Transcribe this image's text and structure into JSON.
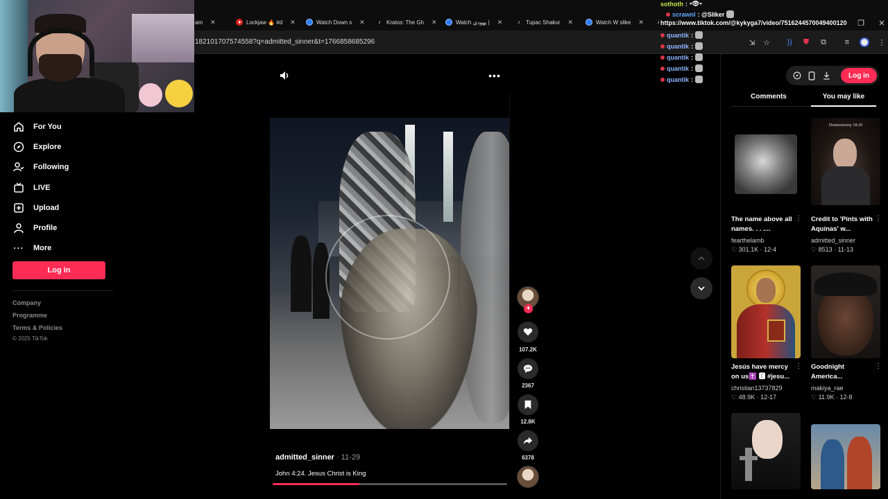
{
  "browser": {
    "tabs": [
      {
        "label": "am",
        "favicon": "none"
      },
      {
        "label": "Lockjaw 🔥 #d",
        "favicon": "youtube-icon"
      },
      {
        "label": "Watch Down s",
        "favicon": "chrome-icon"
      },
      {
        "label": "Kratos: The Gh",
        "favicon": "tiktok-icon"
      },
      {
        "label": "Watch يهودي |",
        "favicon": "chrome-icon"
      },
      {
        "label": "Tupac Shakur",
        "favicon": "tiktok-icon"
      },
      {
        "label": "Watch W slike",
        "favicon": "chrome-icon"
      }
    ],
    "url": "182101707574558?q=admitted_sinner&t=1766858685296"
  },
  "chat": {
    "messages": [
      {
        "user": "sothoth",
        "text": ":",
        "color": "#c6e24a"
      },
      {
        "user": "scrawnl",
        "text": ": @Sliker",
        "color": "#5fa7ff"
      },
      {
        "user": "quantik",
        "text": ":",
        "color": "#8fb4ff"
      },
      {
        "user": "quantik",
        "text": ":",
        "color": "#8fb4ff"
      },
      {
        "user": "quantik",
        "text": ":",
        "color": "#8fb4ff"
      },
      {
        "user": "quantik",
        "text": ":",
        "color": "#8fb4ff"
      },
      {
        "user": "quantik",
        "text": ":",
        "color": "#8fb4ff"
      }
    ],
    "link": "https://www.tiktok.com/@kykyga7/video/7516244570049400120"
  },
  "sidebar": {
    "items": [
      {
        "label": "For You",
        "icon": "home-icon"
      },
      {
        "label": "Explore",
        "icon": "compass-icon"
      },
      {
        "label": "Following",
        "icon": "following-icon"
      },
      {
        "label": "LIVE",
        "icon": "live-icon"
      },
      {
        "label": "Upload",
        "icon": "upload-icon"
      },
      {
        "label": "Profile",
        "icon": "profile-icon"
      },
      {
        "label": "More",
        "icon": "more-icon"
      }
    ],
    "login_label": "Log in",
    "footer_links": [
      "Company",
      "Programme",
      "Terms & Policies"
    ],
    "copyright": "© 2025 TikTok"
  },
  "video": {
    "author": "admitted_sinner",
    "date": " · 11-29",
    "caption": "John 4:24. Jesus Christ is King",
    "progress": 0.37,
    "likes": "107.2K",
    "comments": "2367",
    "saves": "12.8K",
    "shares": "6378"
  },
  "right_panel": {
    "login_label": "Log in",
    "tabs": [
      "Comments",
      "You may like"
    ],
    "active_tab": "You may like",
    "cards": [
      {
        "title": "The name above all names. . . ....",
        "author": "fearthelamb",
        "likes": "301.1K",
        "date": "12-4",
        "overlay": ""
      },
      {
        "title": "Credit to 'Pints with Aquinas' w...",
        "author": "admitted_sinner",
        "likes": "8513",
        "date": "11-13",
        "overlay": "Deuteronomy 18:20"
      },
      {
        "title": "Jesús have mercy on us✝️ 🅴 #jesu...",
        "author": "christian13737829",
        "likes": "48.9K",
        "date": "12-17",
        "overlay": ""
      },
      {
        "title": "Goodnight America...",
        "author": "makiya_rae",
        "likes": "11.9K",
        "date": "12-8",
        "overlay": ""
      },
      {
        "title": "",
        "author": "",
        "likes": "",
        "date": "",
        "overlay": ""
      },
      {
        "title": "",
        "author": "",
        "likes": "",
        "date": "",
        "overlay": ""
      }
    ]
  },
  "colors": {
    "accent": "#fe2c55",
    "background": "#000000"
  }
}
